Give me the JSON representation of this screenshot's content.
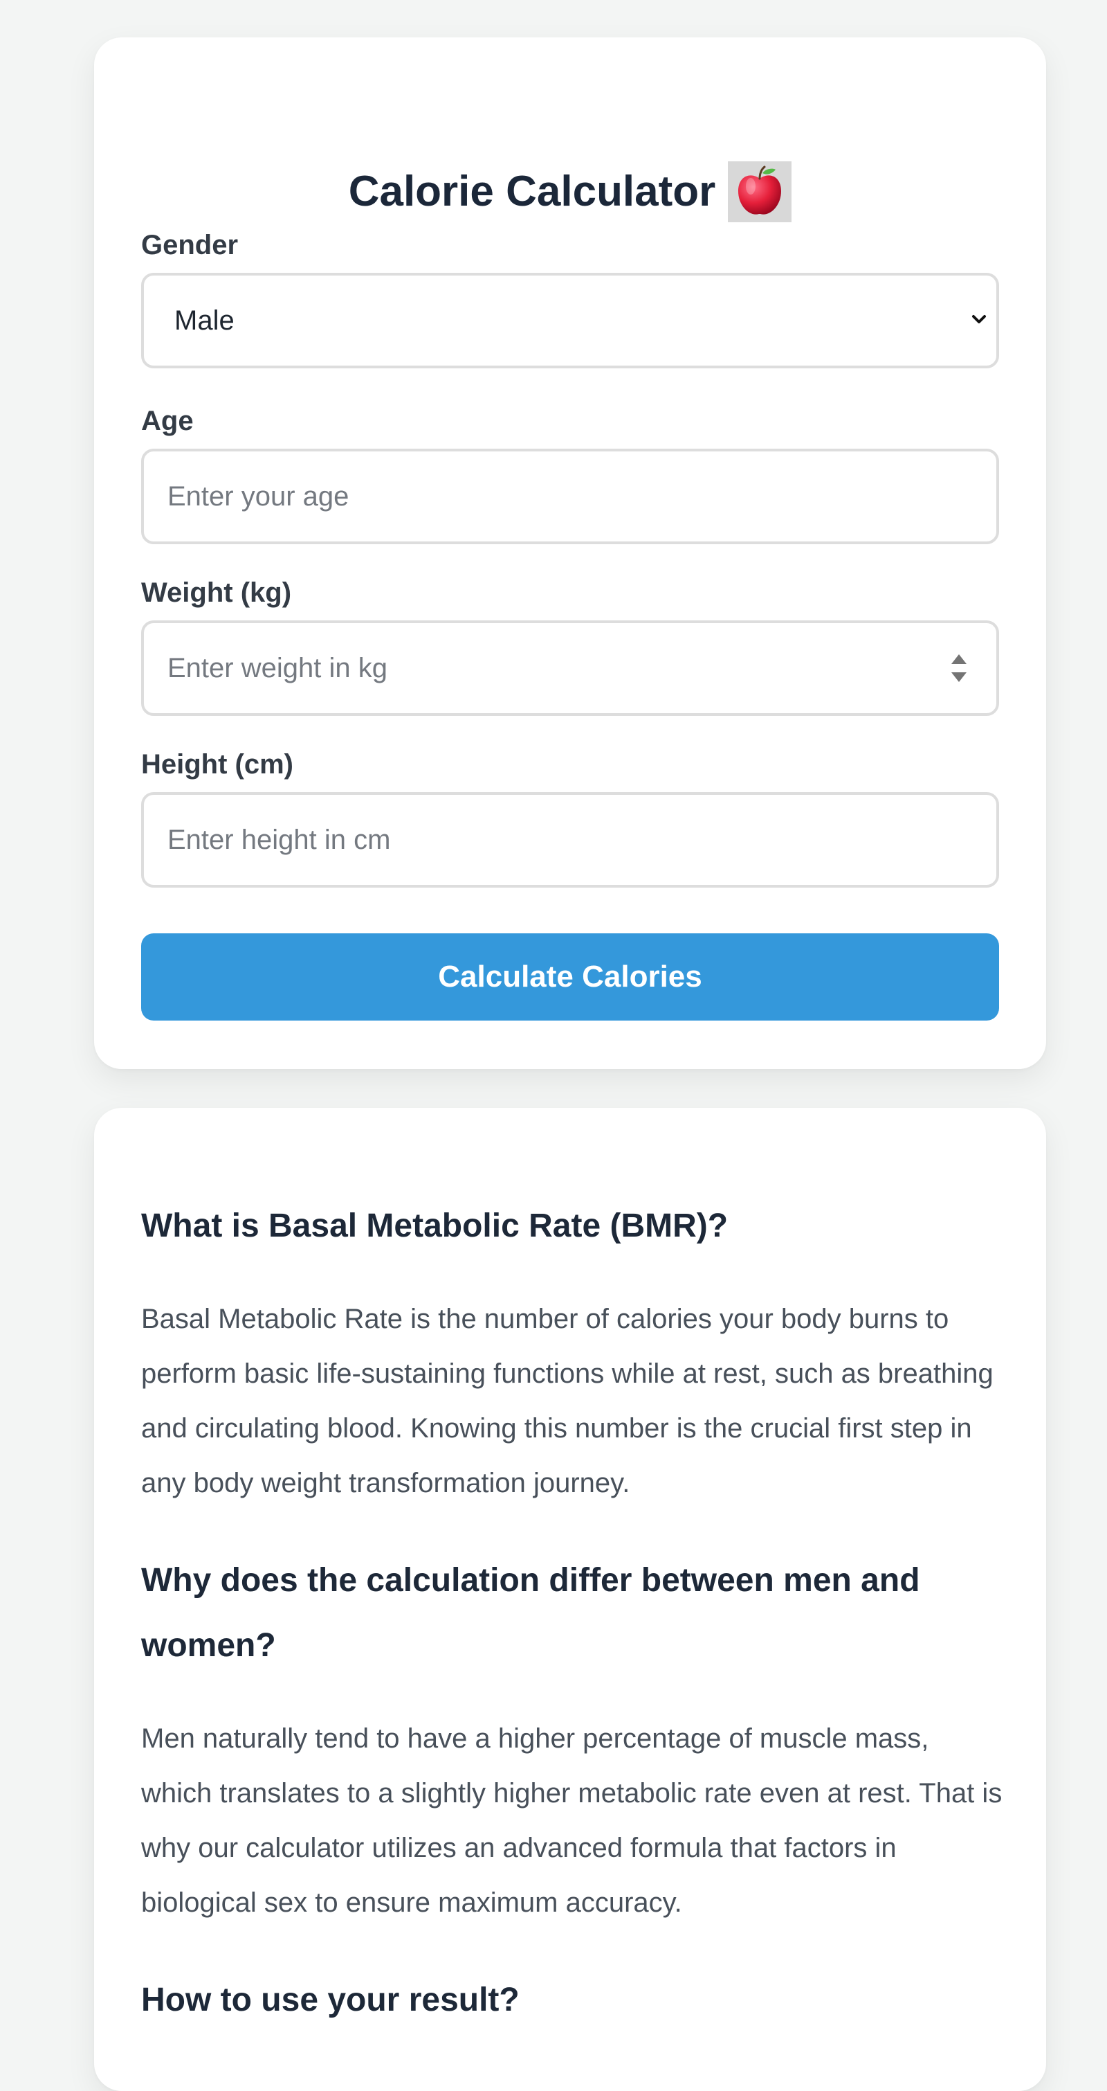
{
  "calculator": {
    "title": "Calorie Calculator",
    "emoji_name": "red-apple",
    "fields": {
      "gender": {
        "label": "Gender",
        "selected": "Male"
      },
      "age": {
        "label": "Age",
        "placeholder": "Enter your age"
      },
      "weight": {
        "label": "Weight (kg)",
        "placeholder": "Enter weight in kg"
      },
      "height": {
        "label": "Height (cm)",
        "placeholder": "Enter height in cm"
      }
    },
    "button_label": "Calculate Calories"
  },
  "info": {
    "sections": [
      {
        "heading": "What is Basal Metabolic Rate (BMR)?",
        "paragraph": "Basal Metabolic Rate is the number of calories your body burns to perform basic life-sustaining functions while at rest, such as breathing and circulating blood. Knowing this number is the crucial first step in any body weight transformation journey."
      },
      {
        "heading": "Why does the calculation differ between men and women?",
        "paragraph": "Men naturally tend to have a higher percentage of muscle mass, which translates to a slightly higher metabolic rate even at rest. That is why our calculator utilizes an advanced formula that factors in biological sex to ensure maximum accuracy."
      },
      {
        "heading": "How to use your result?"
      }
    ]
  },
  "colors": {
    "page_background": "#f3f5f4",
    "card_background": "#ffffff",
    "accent": "#3498db",
    "heading_text": "#1b2739",
    "body_text": "#48505a",
    "input_border": "#dddddd"
  }
}
